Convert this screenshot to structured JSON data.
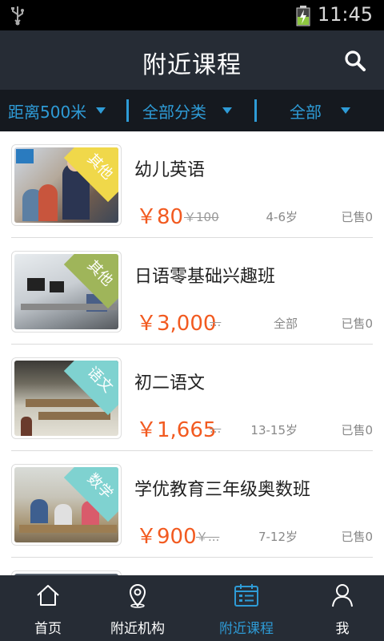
{
  "status_bar": {
    "time": "11:45"
  },
  "header": {
    "title": "附近课程"
  },
  "filters": [
    {
      "label": "距离500米"
    },
    {
      "label": "全部分类"
    },
    {
      "label": "全部"
    }
  ],
  "courses": [
    {
      "name": "幼儿英语",
      "price": "￥80",
      "original_price": "￥100",
      "age": "4-6岁",
      "sold": "已售0",
      "tag": "其他",
      "tag_color": "#f0d84a"
    },
    {
      "name": "日语零基础兴趣班",
      "price": "￥3,000",
      "original_price": "...",
      "age": "全部",
      "sold": "已售0",
      "tag": "其他",
      "tag_color": "#9fb55a"
    },
    {
      "name": "初二语文",
      "price": "￥1,665",
      "original_price": "...",
      "age": "13-15岁",
      "sold": "已售0",
      "tag": "语文",
      "tag_color": "#7fd2d0"
    },
    {
      "name": "学优教育三年级奥数班",
      "price": "￥900",
      "original_price": "￥...",
      "age": "7-12岁",
      "sold": "已售0",
      "tag": "数学",
      "tag_color": "#7fd2d0"
    }
  ],
  "tabs": [
    {
      "label": "首页",
      "icon": "home-icon"
    },
    {
      "label": "附近机构",
      "icon": "location-pin-icon"
    },
    {
      "label": "附近课程",
      "icon": "calendar-list-icon",
      "active": true
    },
    {
      "label": "我",
      "icon": "person-icon"
    }
  ],
  "colors": {
    "accent": "#2e9bd6",
    "price": "#f25a20",
    "appbar": "#262c35",
    "filterbar": "#15191f"
  }
}
